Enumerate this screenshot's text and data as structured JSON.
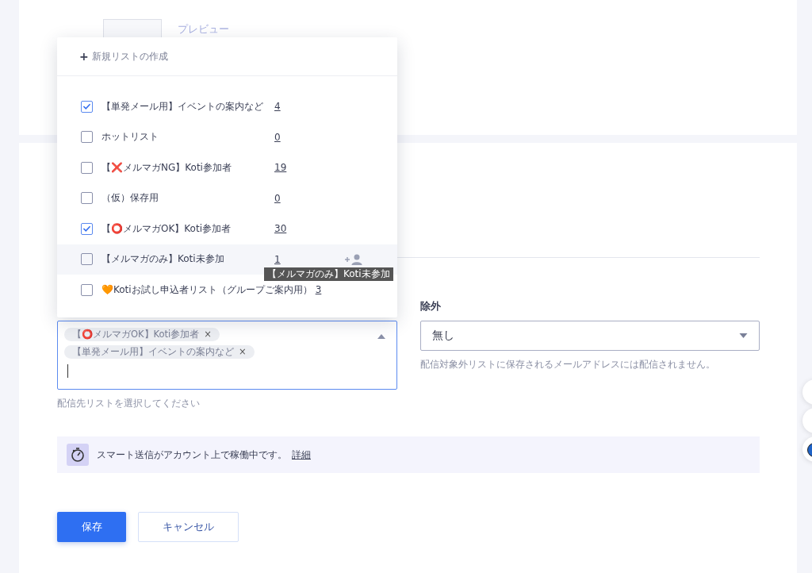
{
  "preview": {
    "label": "プレビュー"
  },
  "list_dropdown": {
    "create_label": "新規リストの作成",
    "create_icon": "+",
    "items": [
      {
        "label": "【単発メール用】イベントの案内など",
        "count": "4",
        "checked": true,
        "hovered": false
      },
      {
        "label": "ホットリスト",
        "count": "0",
        "checked": false,
        "hovered": false
      },
      {
        "label": "【❌メルマガNG】Koti参加者",
        "count": "19",
        "checked": false,
        "hovered": false
      },
      {
        "label": "（仮）保存用",
        "count": "0",
        "checked": false,
        "hovered": false
      },
      {
        "label": "【⭕メルマガOK】Koti参加者",
        "count": "30",
        "checked": true,
        "hovered": false
      },
      {
        "label": "【メルマガのみ】Koti未参加",
        "count": "1",
        "checked": false,
        "hovered": true
      },
      {
        "label": "🧡Kotiお試し申込者リスト（グループご案内用）",
        "count": "3",
        "checked": false,
        "hovered": false
      }
    ],
    "tooltip": "【メルマガのみ】Koti未参加"
  },
  "recipients": {
    "tags": [
      {
        "label": "【⭕メルマガOK】Koti参加者",
        "remove": "×"
      },
      {
        "label": "【単発メール用】イベントの案内など",
        "remove": "×"
      }
    ],
    "help": "配信先リストを選択してください"
  },
  "exclude": {
    "label": "除外",
    "value": "無し",
    "help": "配信対象外リストに保存されるメールアドレスには配信されません。"
  },
  "smart_send": {
    "text": "スマート送信がアカウント上で稼働中です。",
    "link": "詳細"
  },
  "buttons": {
    "save": "保存",
    "cancel": "キャンセル"
  }
}
